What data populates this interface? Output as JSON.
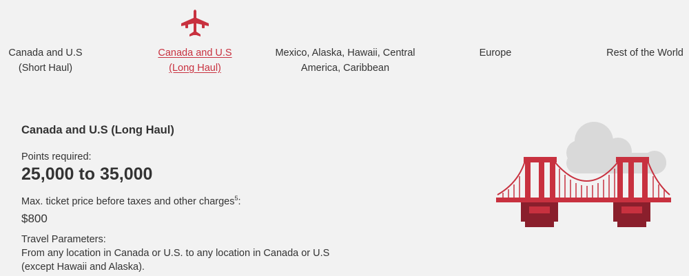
{
  "colors": {
    "accent": "#c8313f",
    "dark_accent": "#8a1f2c",
    "cloud": "#d9d9d9",
    "background": "#f2f2f2",
    "text": "#333333"
  },
  "tabs": [
    {
      "line1": "Canada and U.S",
      "line2": "(Short Haul)",
      "active": false
    },
    {
      "line1": "Canada and U.S",
      "line2": "(Long Haul)",
      "active": true,
      "icon": "airplane-icon"
    },
    {
      "line1": "Mexico, Alaska, Hawaii, Central",
      "line2": "America, Caribbean",
      "active": false
    },
    {
      "line1": "Europe",
      "line2": "",
      "active": false
    },
    {
      "line1": "Rest of the World",
      "line2": "",
      "active": false
    }
  ],
  "detail": {
    "title": "Canada and U.S (Long Haul)",
    "points_label": "Points required:",
    "points_value": "25,000 to 35,000",
    "max_label": "Max. ticket price before taxes and other charges",
    "max_footnote": "5",
    "max_colon": ":",
    "price": "$800",
    "params_label": "Travel Parameters:",
    "params_text": "From any location in Canada or U.S. to any location in Canada or U.S (except Hawaii and Alaska)."
  },
  "illustration": {
    "icon": "bridge-icon",
    "cloud_icon": "cloud-icon"
  }
}
